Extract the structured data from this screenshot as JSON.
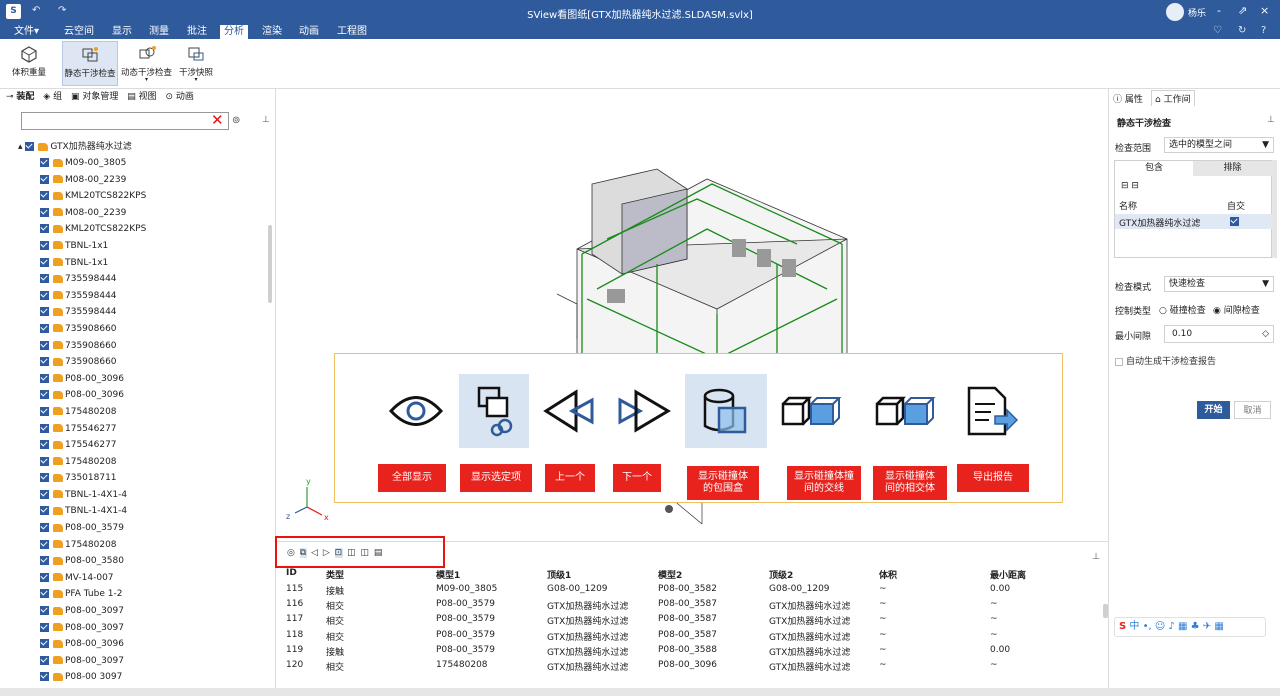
{
  "window": {
    "title": "SView看图纸[GTX加热器纯水过滤.SLDASM.svlx]",
    "user": "杨乐",
    "controls": [
      "-",
      "⇗",
      "×"
    ],
    "quick_actions": [
      "↶",
      "↷"
    ]
  },
  "menu": {
    "items": [
      "文件▾",
      "云空间",
      "显示",
      "测量",
      "批注",
      "分析",
      "渲染",
      "动画",
      "工程图"
    ],
    "active": "分析",
    "right_icons": [
      "♡",
      "↻",
      "?"
    ]
  },
  "ribbon": {
    "buttons": [
      {
        "label": "体积重量"
      },
      {
        "label": "静态干涉检查",
        "active": true
      },
      {
        "label": "动态干涉检查"
      },
      {
        "label": "干涉快照"
      }
    ]
  },
  "left_panel": {
    "tabs": [
      "装配",
      "组",
      "对象管理",
      "视图",
      "动画"
    ],
    "search_value": "",
    "root": "GTX加热器纯水过滤",
    "items": [
      "M09-00_3805",
      "M08-00_2239",
      "KML20TCS822KPS",
      "M08-00_2239",
      "KML20TCS822KPS",
      "TBNL-1x1",
      "TBNL-1x1",
      "735598444",
      "735598444",
      "735598444",
      "735908660",
      "735908660",
      "735908660",
      "P08-00_3096",
      "P08-00_3096",
      "175480208",
      "175546277",
      "175546277",
      "175480208",
      "735018711",
      "TBNL-1-4X1-4",
      "TBNL-1-4X1-4",
      "P08-00_3579",
      "175480208",
      "P08-00_3580",
      "MV-14-007",
      "PFA Tube 1-2",
      "P08-00_3097",
      "P08-00_3097",
      "P08-00_3096",
      "P08-00_3097",
      "P08-00 3097"
    ]
  },
  "overlay": {
    "icon_names": [
      "eye-icon",
      "show-selected-icon",
      "prev-icon",
      "next-icon",
      "bounding-box-icon",
      "intersect-line-icon",
      "intersect-volume-icon",
      "export-report-icon"
    ],
    "labels": [
      "全部显示",
      "显示选定项",
      "上一个",
      "下一个",
      "显示碰撞体\n的包围盒",
      "显示碰撞体撞\n间的交线",
      "显示碰撞体\n间的相交体",
      "导出报告"
    ]
  },
  "axis": {
    "x": "x",
    "y": "y",
    "z": "z"
  },
  "results": {
    "columns": [
      "ID",
      "类型",
      "模型1",
      "顶级1",
      "模型2",
      "顶级2",
      "体积",
      "最小距离"
    ],
    "rows": [
      [
        "115",
        "接触",
        "M09-00_3805",
        "G08-00_1209",
        "P08-00_3582",
        "G08-00_1209",
        "~",
        "0.00"
      ],
      [
        "116",
        "相交",
        "P08-00_3579",
        "GTX加热器纯水过滤",
        "P08-00_3587",
        "GTX加热器纯水过滤",
        "~",
        "~"
      ],
      [
        "117",
        "相交",
        "P08-00_3579",
        "GTX加热器纯水过滤",
        "P08-00_3587",
        "GTX加热器纯水过滤",
        "~",
        "~"
      ],
      [
        "118",
        "相交",
        "P08-00_3579",
        "GTX加热器纯水过滤",
        "P08-00_3587",
        "GTX加热器纯水过滤",
        "~",
        "~"
      ],
      [
        "119",
        "接触",
        "P08-00_3579",
        "GTX加热器纯水过滤",
        "P08-00_3588",
        "GTX加热器纯水过滤",
        "~",
        "0.00"
      ],
      [
        "120",
        "相交",
        "175480208",
        "GTX加热器纯水过滤",
        "P08-00_3096",
        "GTX加热器纯水过滤",
        "~",
        "~"
      ]
    ]
  },
  "right_panel": {
    "tabs": [
      "属性",
      "工作间"
    ],
    "title": "静态干涉检查",
    "scope_label": "检查范围",
    "scope_value": "选中的模型之间",
    "include_tab": "包含",
    "exclude_tab": "排除",
    "col_name": "名称",
    "col_self": "自交",
    "model_row": "GTX加热器纯水过滤",
    "mode_label": "检查模式",
    "mode_value": "快速检查",
    "control_label": "控制类型",
    "opt_collision": "碰撞检查",
    "opt_clearance": "间隙检查",
    "min_gap_label": "最小间隙",
    "min_gap_value": "0.10",
    "auto_report": "自动生成干涉检查报告",
    "start": "开始",
    "cancel": "取消"
  },
  "ime": {
    "text": "中 •, ☺ ♪ ▦ ♣ ✈ ▦"
  }
}
